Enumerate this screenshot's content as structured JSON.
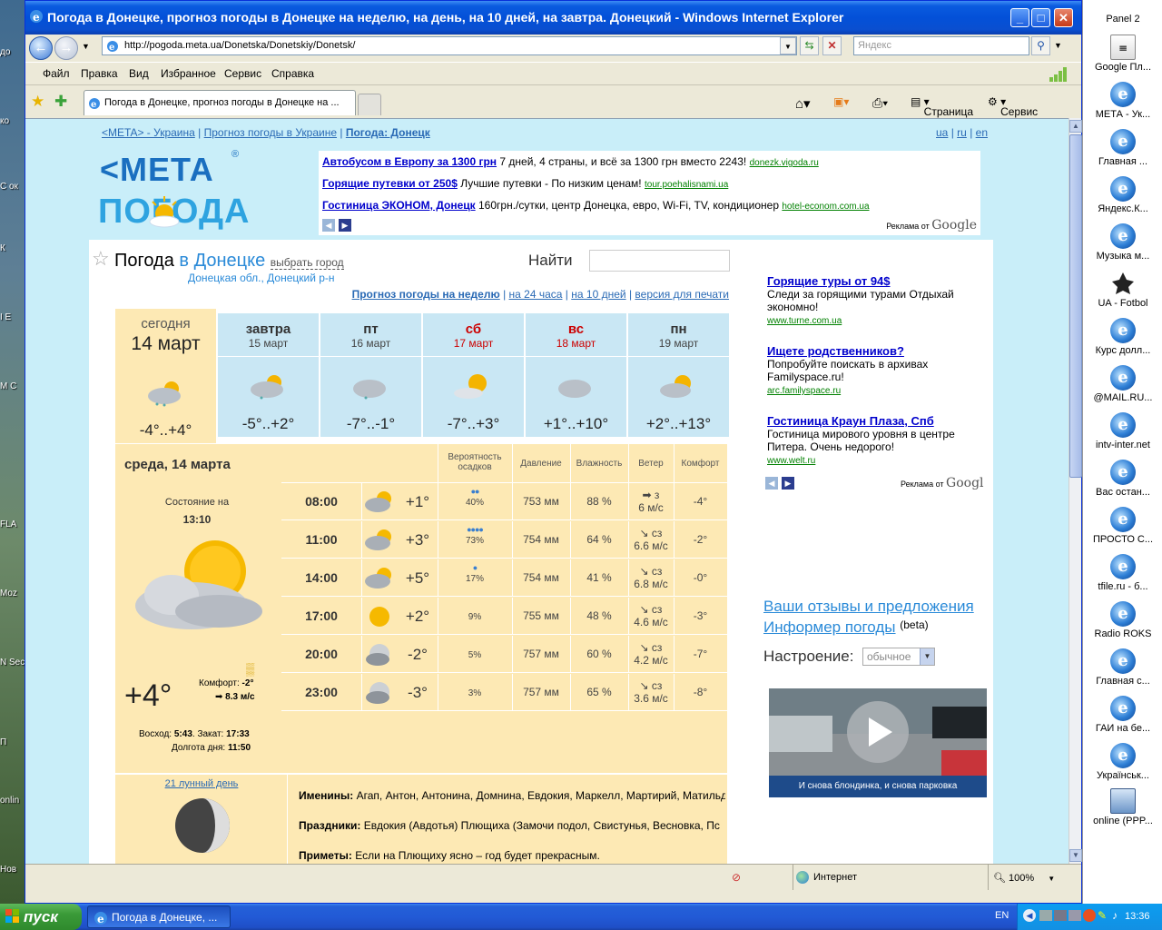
{
  "window": {
    "title": "Погода в Донецке, прогноз погоды в Донецке на неделю, на день, на 10 дней, на завтра. Донецкий  - Windows Internet Explorer",
    "address": "http://pogoda.meta.ua/Donetska/Donetskiy/Donetsk/",
    "search_placeholder": "Яндекс",
    "tab_title": "Погода в Донецке, прогноз погоды в Донецке на ...",
    "menu": [
      "Файл",
      "Правка",
      "Вид",
      "Избранное",
      "Сервис",
      "Справка"
    ],
    "cmd_page": "Страница",
    "cmd_service": "Сервис",
    "status_zone": "Интернет",
    "zoom": "100%"
  },
  "page": {
    "breadcrumb": {
      "meta": "<META> - Украина",
      "sep": "|",
      "forecast_ua": "Прогноз погоды в Украине",
      "current": "Погода: Донецк"
    },
    "langs": {
      "ua": "ua",
      "ru": "ru",
      "en": "en",
      "sep": "|"
    },
    "logo": {
      "top": "<МЕТА",
      "reg": "®",
      "bottom": "ПОГОДА"
    },
    "ads_top": [
      {
        "title": "Автобусом в Европу за 1300 грн",
        "text": "7 дней, 4 страны, и всё за 1300 грн вместо 2243!",
        "url": "donezk.vigoda.ru"
      },
      {
        "title": "Горящие путевки от 250$",
        "text": "Лучшие путевки - По низким ценам!",
        "url": "tour.poehalisnami.ua"
      },
      {
        "title": "Гостиница ЭКОНОМ, Донецк",
        "text": "160грн./сутки, центр Донецка, евро, Wi-Fi, TV, кондиционер",
        "url": "hotel-econom.com.ua"
      }
    ],
    "ads_by": "Реклама от",
    "google": "Google",
    "heading": {
      "prefix": "Погода",
      "city": "в Донецке",
      "choose": "выбрать город",
      "region": "Донецкая обл., Донецкий р-н"
    },
    "find_label": "Найти",
    "forecast_links": {
      "week": "Прогноз погоды на неделю",
      "h24": "на 24 часа",
      "d10": "на 10 дней",
      "print": "версия для печати",
      "sep": "|"
    },
    "days": [
      {
        "name": "сегодня",
        "date": "14 март",
        "temp": "-4°..+4°"
      },
      {
        "name": "завтра",
        "date": "15 март",
        "temp": "-5°..+2°"
      },
      {
        "name": "пт",
        "date": "16 март",
        "temp": "-7°..-1°"
      },
      {
        "name": "сб",
        "date": "17 март",
        "temp": "-7°..+3°"
      },
      {
        "name": "вс",
        "date": "18 март",
        "temp": "+1°..+10°"
      },
      {
        "name": "пн",
        "date": "19 март",
        "temp": "+2°..+13°"
      }
    ],
    "detail": {
      "date_title": "среда, 14 марта",
      "state_label": "Состояние на",
      "state_time": "13:10",
      "temp_now": "+4°",
      "comfort_label": "Комфорт:",
      "comfort_value": "-2°",
      "wind_now": "8.3 м/с",
      "sunrise_label": "Восход:",
      "sunrise": "5:43",
      "sunset_label": "Закат:",
      "sunset": "17:33",
      "daylen_label": "Долгота дня:",
      "daylen": "11:50",
      "columns": {
        "precip": "Вероятность осадков",
        "pressure": "Давление",
        "humidity": "Влажность",
        "wind": "Ветер",
        "comfort": "Комфорт"
      },
      "hours": [
        {
          "time": "08:00",
          "temp": "+1°",
          "precip": "40%",
          "pressure": "753 мм",
          "humidity": "88 %",
          "wind_dir": "з",
          "wind_speed": "6 м/с",
          "comfort": "-4°"
        },
        {
          "time": "11:00",
          "temp": "+3°",
          "precip": "73%",
          "pressure": "754 мм",
          "humidity": "64 %",
          "wind_dir": "сз",
          "wind_speed": "6.6 м/с",
          "comfort": "-2°"
        },
        {
          "time": "14:00",
          "temp": "+5°",
          "precip": "17%",
          "pressure": "754 мм",
          "humidity": "41 %",
          "wind_dir": "сз",
          "wind_speed": "6.8 м/с",
          "comfort": "-0°"
        },
        {
          "time": "17:00",
          "temp": "+2°",
          "precip": "9%",
          "pressure": "755 мм",
          "humidity": "48 %",
          "wind_dir": "сз",
          "wind_speed": "4.6 м/с",
          "comfort": "-3°"
        },
        {
          "time": "20:00",
          "temp": "-2°",
          "precip": "5%",
          "pressure": "757 мм",
          "humidity": "60 %",
          "wind_dir": "сз",
          "wind_speed": "4.2 м/с",
          "comfort": "-7°"
        },
        {
          "time": "23:00",
          "temp": "-3°",
          "precip": "3%",
          "pressure": "757 мм",
          "humidity": "65 %",
          "wind_dir": "сз",
          "wind_speed": "3.6 м/с",
          "comfort": "-8°"
        }
      ]
    },
    "moon": {
      "day_link": "21 лунный день"
    },
    "names_label": "Именины:",
    "names": "Агап, Антон, Антонина, Домнина, Евдокия, Маркелл, Мартирий, Матильда",
    "holidays_label": "Праздники:",
    "holidays": "Евдокия (Авдотья) Плющиха (Замочи подол, Свистунья, Весновка, Пс",
    "signs_label": "Приметы:",
    "signs": "Если на Плющиху ясно – год будет прекрасным.",
    "ads_right": [
      {
        "title": "Горящие туры от 94$",
        "text": "Следи за горящими турами Отдыхай экономно!",
        "url": "www.turne.com.ua"
      },
      {
        "title": "Ищете родственников?",
        "text": "Попробуйте поискать в архивах Familyspace.ru!",
        "url": "arc.familyspace.ru"
      },
      {
        "title": "Гостиница Краун Плаза, Спб",
        "text": "Гостиница мирового уровня в центре Питера. Очень недорого!",
        "url": "www.welt.ru"
      }
    ],
    "google_short": "Googl",
    "feedback": "Ваши отзывы и предложения",
    "informer": "Информер погоды",
    "beta": "(beta)",
    "mood_label": "Настроение:",
    "mood_value": "обычное",
    "video_caption": "И снова блондинка, и снова парковка"
  },
  "desktop_left": [
    "до",
    "ко",
    "С ок",
    "К",
    "I E",
    "М С",
    "FLA",
    "Moz",
    "N Sec",
    "П",
    "onlin",
    "Нов"
  ],
  "panel": {
    "title": "Panel 2",
    "items": [
      "Google Пл...",
      "МЕТА - Ук...",
      "Главная ...",
      "Яндекс.К...",
      "Музыка м...",
      "UA - Fotbol",
      "Курс долл...",
      "@MAIL.RU...",
      "intv-inter.net",
      "Вас остан...",
      "ПРОСТО С...",
      "tfile.ru - б...",
      "Radio ROKS",
      "Главная с...",
      "ГАИ на бе...",
      "Українськ...",
      "online (PPP..."
    ]
  },
  "taskbar": {
    "start": "пуск",
    "task": "Погода в Донецке, ...",
    "lang": "EN",
    "clock": "13:36"
  }
}
